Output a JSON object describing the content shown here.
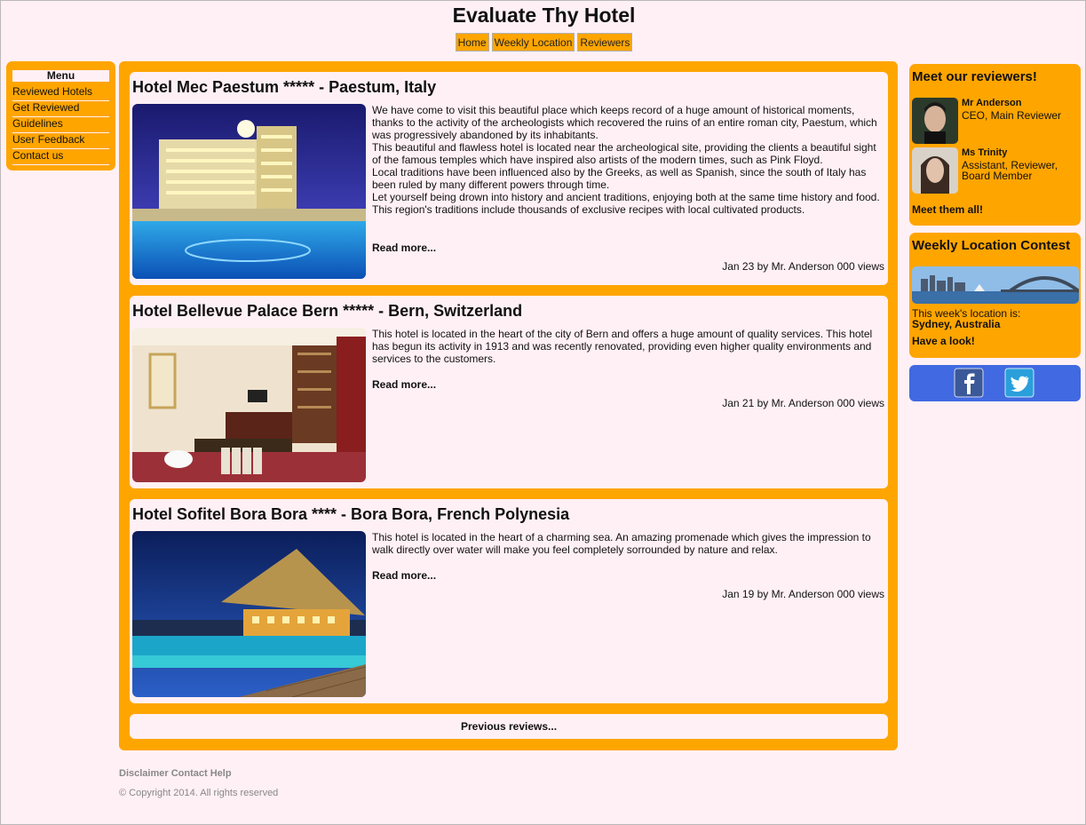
{
  "site": {
    "title": "Evaluate Thy Hotel"
  },
  "nav": {
    "items": [
      "Home",
      "Weekly Location",
      "Reviewers"
    ]
  },
  "menu": {
    "title": "Menu",
    "items": [
      "Reviewed Hotels",
      "Get Reviewed",
      "Guidelines",
      "User Feedback",
      "Contact us"
    ]
  },
  "reviews": [
    {
      "title": "Hotel Mec Paestum ***** - Paestum, Italy",
      "paragraphs": [
        "We have come to visit this beautiful place which keeps record of a huge amount of historical moments, thanks to the activity of the archeologists which recovered the ruins of an entire roman city, Paestum, which was progressively abandoned by its inhabitants.",
        "This beautiful and flawless hotel is located near the archeological site, providing the clients a beautiful sight of the famous temples which have inspired also artists of the modern times, such as Pink Floyd.",
        "Local traditions have been influenced also by the Greeks, as well as Spanish, since the south of Italy has been ruled by many different powers through time.",
        "Let yourself being drown into history and ancient traditions, enjoying both at the same time history and food.",
        "This region's traditions include thousands of exclusive recipes with local cultivated products."
      ],
      "read_more": "Read more...",
      "meta": "Jan 23 by Mr. Anderson 000 views"
    },
    {
      "title": "Hotel Bellevue Palace Bern ***** - Bern, Switzerland",
      "paragraphs": [
        "This hotel is located in the heart of the city of Bern and offers a huge amount of quality services. This hotel has begun its activity in 1913 and was recently renovated, providing even higher quality environments and services to the customers."
      ],
      "read_more": "Read more...",
      "meta": "Jan 21 by Mr. Anderson 000 views"
    },
    {
      "title": "Hotel Sofitel Bora Bora **** - Bora Bora, French Polynesia",
      "paragraphs": [
        "This hotel is located in the heart of a charming sea. An amazing promenade which gives the impression to walk directly over water will make you feel completely sorrounded by nature and relax."
      ],
      "read_more": "Read more...",
      "meta": "Jan 19 by Mr. Anderson 000 views"
    }
  ],
  "previous_reviews": "Previous reviews...",
  "reviewers_box": {
    "title": "Meet our reviewers!",
    "reviewers": [
      {
        "name": "Mr Anderson",
        "role": "CEO, Main Reviewer"
      },
      {
        "name": "Ms Trinity",
        "role": "Assistant, Reviewer, Board Member"
      }
    ],
    "link": "Meet them all!"
  },
  "contest_box": {
    "title": "Weekly Location Contest",
    "prefix": "This week's location is:",
    "location": "Sydney, Australia",
    "link": "Have a look!"
  },
  "social": {
    "icons": [
      "facebook-icon",
      "twitter-icon"
    ]
  },
  "footer": {
    "links": [
      "Disclaimer",
      "Contact",
      "Help"
    ],
    "copyright": "© Copyright 2014. All rights reserved"
  },
  "colors": {
    "background": "#fff0f5",
    "accent": "#ffa500",
    "social": "#4169e1"
  }
}
